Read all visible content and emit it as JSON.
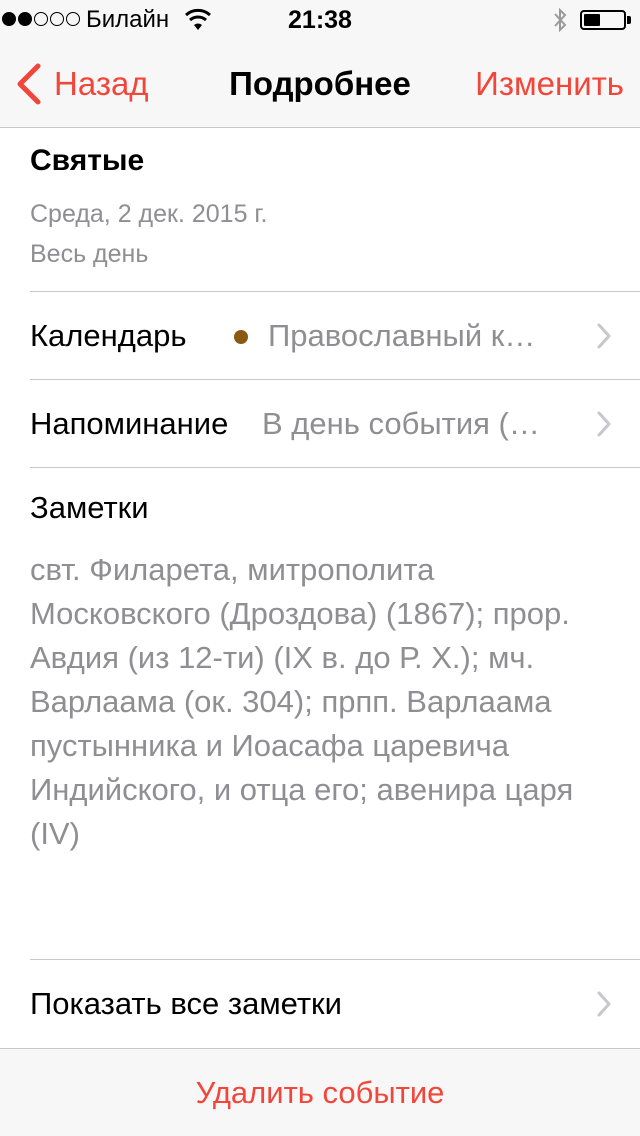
{
  "status_bar": {
    "carrier": "Билайн",
    "time": "21:38",
    "signal_strength": 2,
    "battery_percent": 30
  },
  "nav": {
    "back_label": "Назад",
    "title": "Подробнее",
    "edit_label": "Изменить"
  },
  "event": {
    "title": "Святые",
    "date": "Среда, 2 дек. 2015 г.",
    "all_day": "Весь день"
  },
  "calendar_row": {
    "label": "Календарь",
    "value": "Православный к…",
    "dot_color": "#8b5a12"
  },
  "reminder_row": {
    "label": "Напоминание",
    "value": "В день события (…"
  },
  "notes": {
    "title": "Заметки",
    "text": "свт. Филарета, митрополита Московского (Дроздова) (1867); прор. Авдия (из 12-ти) (IX в. до Р. Х.); мч. Варлаама (ок. 304); прпп. Варлаама пустынника и Иоасафа царевича Индийского, и отца его; авенира царя (IV)"
  },
  "show_all_notes": {
    "label": "Показать все заметки"
  },
  "delete": {
    "label": "Удалить событие"
  },
  "colors": {
    "accent": "#f2463a",
    "secondary_text": "#8e8e93",
    "separator": "#c8c7cc"
  }
}
